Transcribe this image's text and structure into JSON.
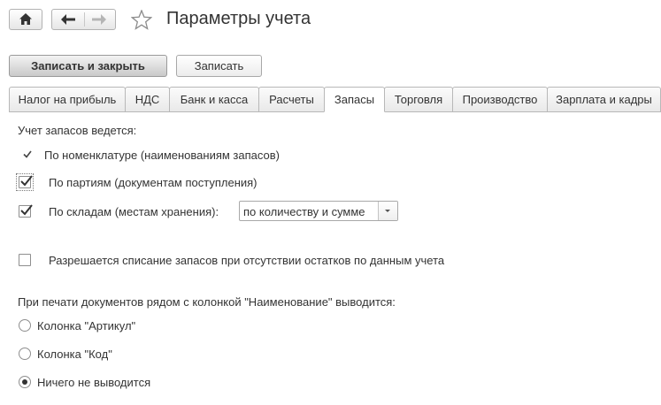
{
  "window": {
    "title": "Параметры учета"
  },
  "toolbar": {
    "save_close_label": "Записать и закрыть",
    "save_label": "Записать"
  },
  "tabs": [
    {
      "label": "Налог на прибыль"
    },
    {
      "label": "НДС"
    },
    {
      "label": "Банк и касса"
    },
    {
      "label": "Расчеты"
    },
    {
      "label": "Запасы",
      "active": true
    },
    {
      "label": "Торговля"
    },
    {
      "label": "Производство"
    },
    {
      "label": "Зарплата и кадры"
    }
  ],
  "inventory": {
    "heading": "Учет запасов ведется:",
    "by_nomenclature": {
      "label": "По номенклатуре (наименованиям запасов)",
      "checked": true
    },
    "by_batches": {
      "label": "По партиям (документам поступления)",
      "checked": true
    },
    "by_warehouses": {
      "label": "По складам (местам хранения):",
      "checked": true
    },
    "warehouse_mode": {
      "value": "по количеству и сумме"
    },
    "allow_negative": {
      "label": "Разрешается списание запасов при отсутствии остатков по данным учета",
      "checked": false
    }
  },
  "printing": {
    "heading": "При печати документов рядом с колонкой \"Наименование\" выводится:",
    "options": [
      {
        "label": "Колонка \"Артикул\"",
        "selected": false
      },
      {
        "label": "Колонка \"Код\"",
        "selected": false
      },
      {
        "label": "Ничего не выводится",
        "selected": true
      }
    ]
  },
  "icons": {
    "home": "home-icon",
    "back": "arrow-left-icon",
    "forward": "arrow-right-icon",
    "favorite": "star-icon",
    "dropdown": "chevron-down-icon"
  }
}
